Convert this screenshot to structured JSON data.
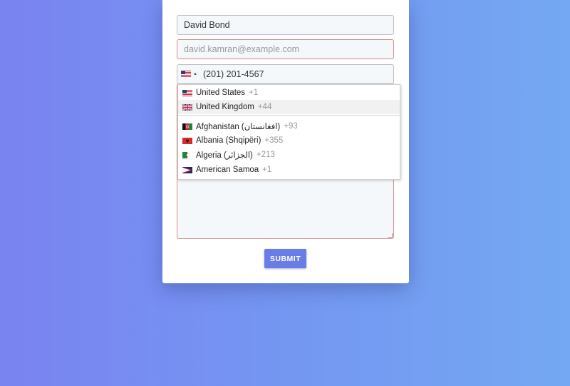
{
  "form": {
    "name_value": "David Bond",
    "email_placeholder": "david.kamran@example.com",
    "phone_value": "(201) 201-4567",
    "phone_selected_flag": "us-flag-icon",
    "submit_label": "SUBMIT"
  },
  "country_dropdown": {
    "preferred": [
      {
        "name": "United States",
        "dial": "+1",
        "flag": "us-flag-icon"
      },
      {
        "name": "United Kingdom",
        "dial": "+44",
        "flag": "gb-flag-icon",
        "highlighted": true
      }
    ],
    "all": [
      {
        "name": "Afghanistan (‫افغانستان‬‎)",
        "dial": "+93",
        "flag": "af-flag-icon"
      },
      {
        "name": "Albania (Shqipëri)",
        "dial": "+355",
        "flag": "al-flag-icon"
      },
      {
        "name": "Algeria (‫الجزائر‬‎)",
        "dial": "+213",
        "flag": "dz-flag-icon"
      },
      {
        "name": "American Samoa",
        "dial": "+1",
        "flag": "as-flag-icon"
      }
    ]
  },
  "colors": {
    "background_start": "#7a83f1",
    "background_end": "#74a8f2",
    "submit_button": "#6a7ce6",
    "invalid_border": "#d68b8b",
    "field_background": "#f4f8fb"
  }
}
